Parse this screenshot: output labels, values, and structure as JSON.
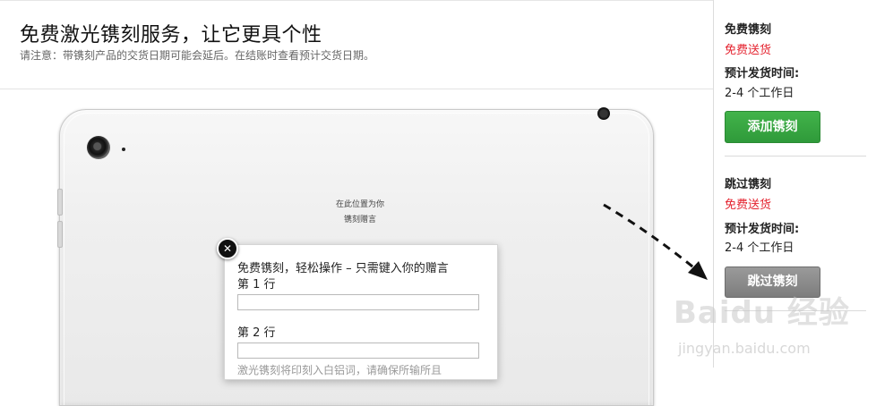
{
  "header": {
    "title": "免费激光镌刻服务，让它更具个性",
    "note": "请注意：带镌刻产品的交货日期可能会延后。在结账时查看预计交货日期。"
  },
  "device": {
    "engraving_preview": [
      "在此位置为你",
      "镌刻赠言"
    ]
  },
  "popup": {
    "close_glyph": "✕",
    "title": "免费镌刻，轻松操作 – 只需键入你的赠言",
    "line1_label": "第 1 行",
    "line1_value": "",
    "line2_label": "第 2 行",
    "line2_value": "",
    "hint": "激光镌刻将印刻入白铝词，请确保所输所且"
  },
  "sidebar": {
    "with_engraving": {
      "heading": "免费镌刻",
      "shipping": "免费送货",
      "ship_time_label": "预计发货时间:",
      "ship_time_value": "2-4 个工作日",
      "button_label": "添加镌刻"
    },
    "without_engraving": {
      "heading": "跳过镌刻",
      "shipping": "免费送货",
      "ship_time_label": "预计发货时间:",
      "ship_time_value": "2-4 个工作日",
      "button_label": "跳过镌刻"
    }
  },
  "watermark": {
    "logo": "Baidu 经验",
    "url": "jingyan.baidu.com"
  },
  "colors": {
    "accent_green": "#2f9a3a",
    "shipping_red": "#e4222e",
    "skip_gray": "#7d7d7d"
  }
}
